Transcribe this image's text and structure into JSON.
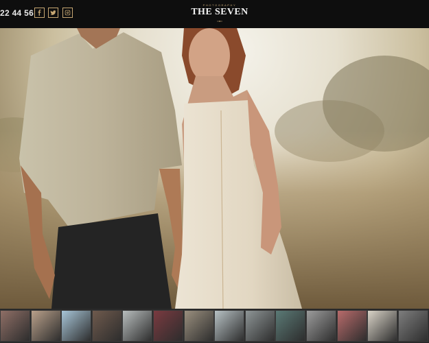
{
  "header": {
    "phone": "22 44 56",
    "logo_kicker": "PHOTOGRAPHY",
    "logo_name": "THE SEVEN",
    "social": [
      {
        "name": "facebook-icon"
      },
      {
        "name": "twitter-icon"
      },
      {
        "name": "instagram-icon"
      }
    ]
  },
  "colors": {
    "accent": "#c8a874",
    "bar": "#0e0e0e",
    "strip": "#2a2a2a"
  },
  "hero": {
    "alt": "couple-photo"
  },
  "thumbnails": [
    {
      "id": "thumb-1",
      "tone": "#8f6f66"
    },
    {
      "id": "thumb-2",
      "tone": "#b9a08a"
    },
    {
      "id": "thumb-3",
      "tone": "#a7c5d8"
    },
    {
      "id": "thumb-4",
      "tone": "#6f5a4d"
    },
    {
      "id": "thumb-5",
      "tone": "#b8bdbd"
    },
    {
      "id": "thumb-6",
      "tone": "#7a3a40"
    },
    {
      "id": "thumb-7",
      "tone": "#9a8f7e"
    },
    {
      "id": "thumb-8",
      "tone": "#b7c1c4"
    },
    {
      "id": "thumb-9",
      "tone": "#8e9596"
    },
    {
      "id": "thumb-10",
      "tone": "#5b7a76"
    },
    {
      "id": "thumb-11",
      "tone": "#9c9c9c"
    },
    {
      "id": "thumb-12",
      "tone": "#b86b6b"
    },
    {
      "id": "thumb-13",
      "tone": "#d9d3c7"
    },
    {
      "id": "thumb-14",
      "tone": "#7d7d7d"
    }
  ]
}
